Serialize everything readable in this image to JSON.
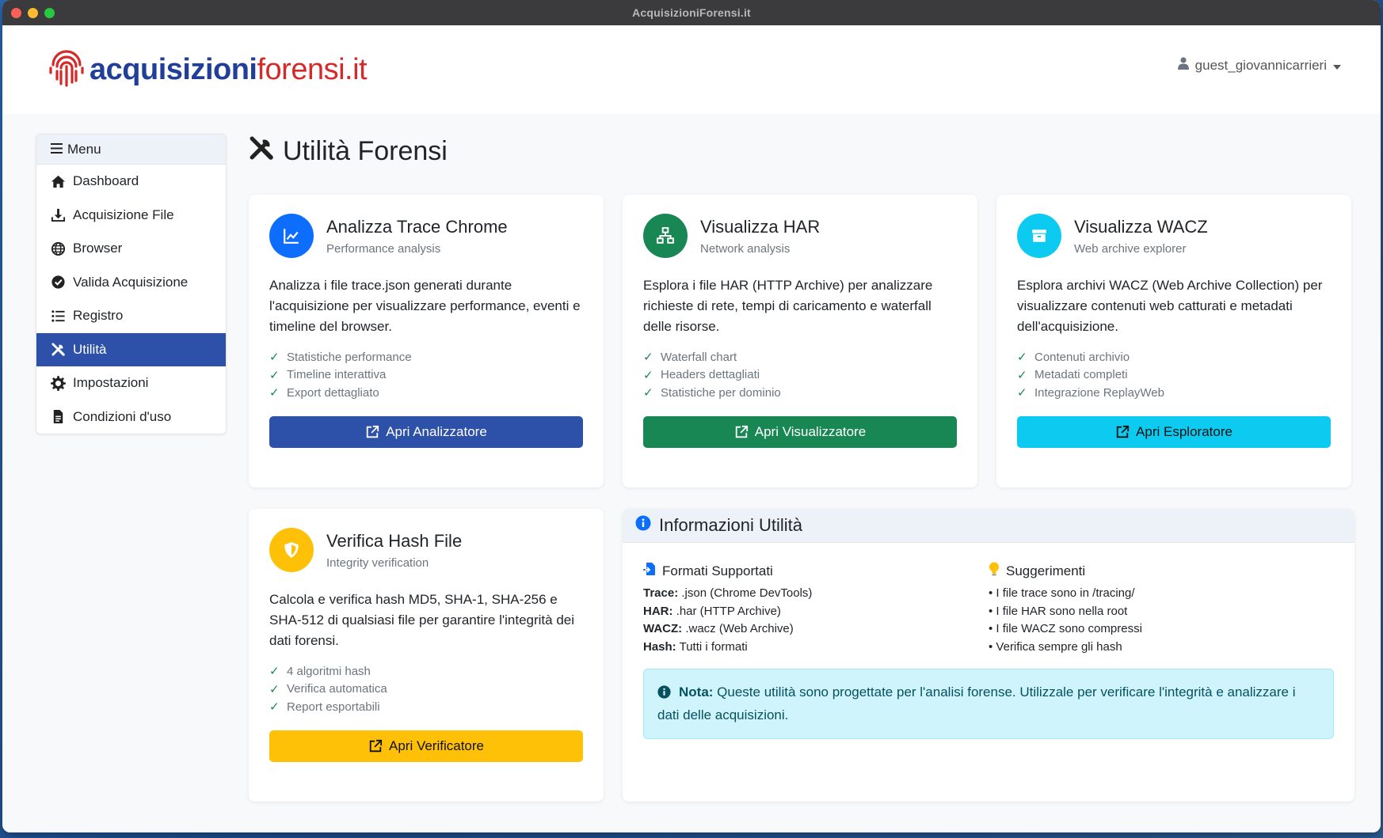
{
  "window": {
    "title": "AcquisizioniForensi.it"
  },
  "brand": {
    "part1": "acquisizioni",
    "part2": "forensi.it"
  },
  "user": {
    "name": "guest_giovannicarrieri"
  },
  "sidebar": {
    "header": "Menu",
    "items": [
      {
        "label": "Dashboard",
        "icon": "home-icon"
      },
      {
        "label": "Acquisizione File",
        "icon": "download-icon"
      },
      {
        "label": "Browser",
        "icon": "globe-icon"
      },
      {
        "label": "Valida Acquisizione",
        "icon": "check-circle-icon"
      },
      {
        "label": "Registro",
        "icon": "list-icon"
      },
      {
        "label": "Utilità",
        "icon": "tools-icon",
        "active": true
      },
      {
        "label": "Impostazioni",
        "icon": "gear-icon"
      },
      {
        "label": "Condizioni d'uso",
        "icon": "document-icon"
      }
    ]
  },
  "page": {
    "title": "Utilità Forensi"
  },
  "cards": [
    {
      "title": "Analizza Trace Chrome",
      "subtitle": "Performance analysis",
      "description": "Analizza i file trace.json generati durante l'acquisizione per visualizzare performance, eventi e timeline del browser.",
      "features": [
        "Statistiche performance",
        "Timeline interattiva",
        "Export dettagliato"
      ],
      "button": "Apri Analizzatore",
      "color": "#0d6efd",
      "button_color": "#2d51a8",
      "icon": "chart-line-icon"
    },
    {
      "title": "Visualizza HAR",
      "subtitle": "Network analysis",
      "description": "Esplora i file HAR (HTTP Archive) per analizzare richieste di rete, tempi di caricamento e waterfall delle risorse.",
      "features": [
        "Waterfall chart",
        "Headers dettagliati",
        "Statistiche per dominio"
      ],
      "button": "Apri Visualizzatore",
      "color": "#198754",
      "button_color": "#198754",
      "icon": "network-icon"
    },
    {
      "title": "Visualizza WACZ",
      "subtitle": "Web archive explorer",
      "description": "Esplora archivi WACZ (Web Archive Collection) per visualizzare contenuti web catturati e metadati dell'acquisizione.",
      "features": [
        "Contenuti archivio",
        "Metadati completi",
        "Integrazione ReplayWeb"
      ],
      "button": "Apri Esploratore",
      "color": "#0dcaf0",
      "button_color": "#0dcaf0",
      "icon": "archive-icon"
    },
    {
      "title": "Verifica Hash File",
      "subtitle": "Integrity verification",
      "description": "Calcola e verifica hash MD5, SHA-1, SHA-256 e SHA-512 di qualsiasi file per garantire l'integrità dei dati forensi.",
      "features": [
        "4 algoritmi hash",
        "Verifica automatica",
        "Report esportabili"
      ],
      "button": "Apri Verificatore",
      "color": "#ffc107",
      "button_color": "#ffc107",
      "icon": "shield-icon"
    }
  ],
  "info": {
    "title": "Informazioni Utilità",
    "formats_title": "Formati Supportati",
    "formats": [
      {
        "key": "Trace:",
        "value": ".json (Chrome DevTools)"
      },
      {
        "key": "HAR:",
        "value": ".har (HTTP Archive)"
      },
      {
        "key": "WACZ:",
        "value": ".wacz (Web Archive)"
      },
      {
        "key": "Hash:",
        "value": "Tutti i formati"
      }
    ],
    "tips_title": "Suggerimenti",
    "tips": [
      "• I file trace sono in /tracing/",
      "• I file HAR sono nella root",
      "• I file WACZ sono compressi",
      "• Verifica sempre gli hash"
    ],
    "note_label": "Nota:",
    "note_text": " Queste utilità sono progettate per l'analisi forense. Utilizzale per verificare l'integrità e analizzare i dati delle acquisizioni."
  }
}
